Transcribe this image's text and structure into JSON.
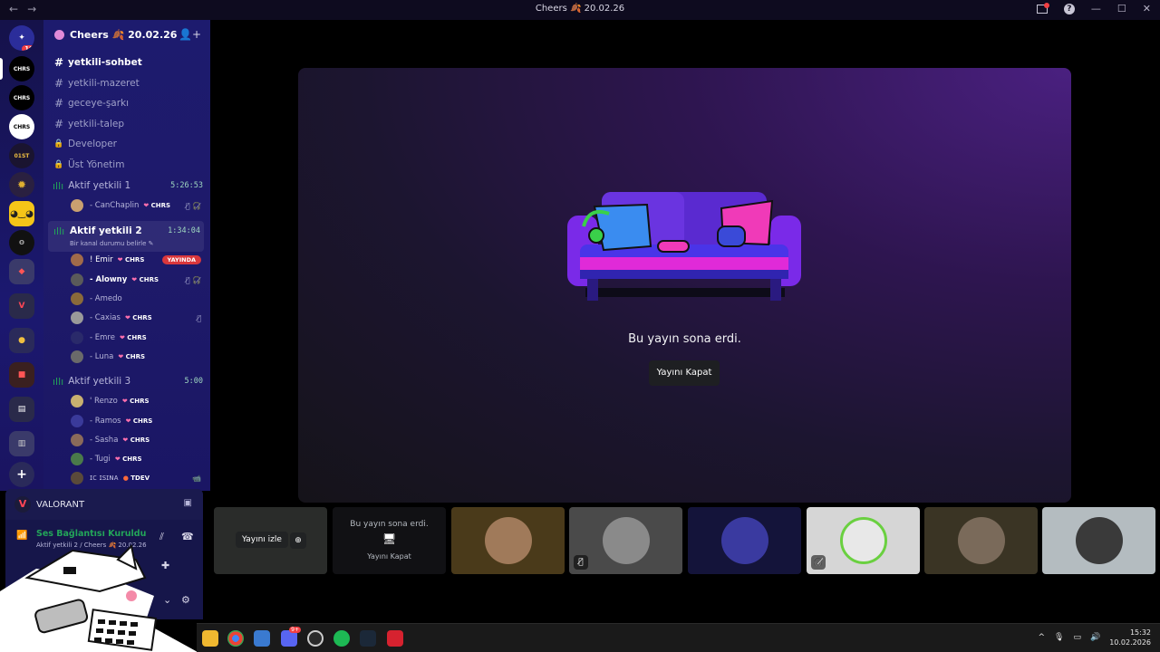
{
  "window": {
    "title": "Cheers 🍂 20.02.26",
    "nav_back": "←",
    "nav_forward": "→",
    "help": "?",
    "min": "—",
    "max": "☐",
    "close": "✕"
  },
  "guilds": {
    "top_badge": "19",
    "items": [
      "CHRS",
      "CHRS",
      "CHRS",
      "01ST",
      "",
      "",
      "",
      "",
      "",
      "",
      "",
      "",
      ""
    ]
  },
  "server": {
    "name": "Cheers 🍂 20.02.26",
    "chevron": "⌄",
    "add_member": "👤+"
  },
  "channels": [
    {
      "name": "yetkili-sohbet",
      "symbol": "#",
      "active": true
    },
    {
      "name": "yetkili-mazeret",
      "symbol": "#"
    },
    {
      "name": "geceye-şarkı",
      "symbol": "#"
    },
    {
      "name": "yetkili-talep",
      "symbol": "#"
    },
    {
      "name": "Developer",
      "symbol": "🔒"
    },
    {
      "name": "Üst Yönetim",
      "symbol": "🔒"
    }
  ],
  "voice": [
    {
      "name": "Aktif yetkili 1",
      "timer": "5:26:53",
      "members": [
        {
          "name": "- CanChaplin",
          "tag": "CHRS",
          "icons": "🎙̸ 🎧̸",
          "color": "#c9a070"
        }
      ]
    },
    {
      "name": "Aktif yetkili 2",
      "timer": "1:34:04",
      "status": "Bir kanal durumu belirle ✎",
      "members": [
        {
          "name": "! Emir",
          "tag": "CHRS",
          "live": "YAYINDA",
          "color": "#a06a4a"
        },
        {
          "name": "- Alowny",
          "tag": "CHRS",
          "icons": "🎙̸ 🎧̸",
          "color": "#5a5a5a"
        },
        {
          "name": "- Amedo",
          "tag": "",
          "color": "#8a6a3a"
        },
        {
          "name": "- Caxias",
          "tag": "CHRS",
          "icons": "🎙̸",
          "color": "#9a9a9a"
        },
        {
          "name": "- Emre",
          "tag": "CHRS",
          "color": "#2a2a6a"
        },
        {
          "name": "- Luna",
          "tag": "CHRS",
          "color": "#6a6a6a"
        }
      ]
    },
    {
      "name": "Aktif yetkili 3",
      "timer": "5:00",
      "members": [
        {
          "name": "' Renzo",
          "tag": "CHRS",
          "color": "#c8b070"
        },
        {
          "name": "- Ramos",
          "tag": "CHRS",
          "color": "#3a3a9a"
        },
        {
          "name": "- Sasha",
          "tag": "CHRS",
          "color": "#8a6a5a"
        },
        {
          "name": "- Tugi",
          "tag": "CHRS",
          "color": "#4a7a4a"
        },
        {
          "name": "ɪᴄ ɪsɪɴᴀ",
          "tag": "TDEV",
          "icons": "📹",
          "color": "#5a4a3a"
        }
      ]
    }
  ],
  "game": {
    "name": "VALORANT",
    "logo": "V"
  },
  "connection": {
    "title": "Ses Bağlantısı Kuruldu",
    "subtitle": "Aktif yetkili 2 / Cheers 🍂 20.02.26"
  },
  "stream": {
    "ended_text": "Bu yayın sona erdi.",
    "close_button": "Yayını Kapat"
  },
  "tiles": [
    {
      "type": "preview",
      "watch": "Yayını izle",
      "zoom": "⊕"
    },
    {
      "type": "ended",
      "text": "Bu yayın sona erdi.",
      "button": "Yayını Kapat",
      "icon": "🖥"
    },
    {
      "type": "avatar",
      "bg": "#4a3a1a",
      "color": "#a07a5a"
    },
    {
      "type": "avatar",
      "bg": "#4a4a4a",
      "color": "#8a8a8a",
      "mute": "🎙̸"
    },
    {
      "type": "avatar",
      "bg": "#14143a",
      "color": "#3a3aa0"
    },
    {
      "type": "avatar",
      "bg": "#d6d6d6",
      "color": "#6ad040",
      "mute": "🎧̸"
    },
    {
      "type": "avatar",
      "bg": "#3a3424",
      "color": "#7a6a5a"
    },
    {
      "type": "avatar",
      "bg": "#b4bcc0",
      "color": "#3a3a3a"
    }
  ],
  "taskbar": {
    "time": "15:32",
    "date": "10.02.2026",
    "discord_badge": "9+",
    "chevron": "^"
  },
  "colors": {
    "accent": "#5865f2",
    "live": "#da373c",
    "online": "#23a559",
    "sidebar": "#1d1b6e"
  }
}
